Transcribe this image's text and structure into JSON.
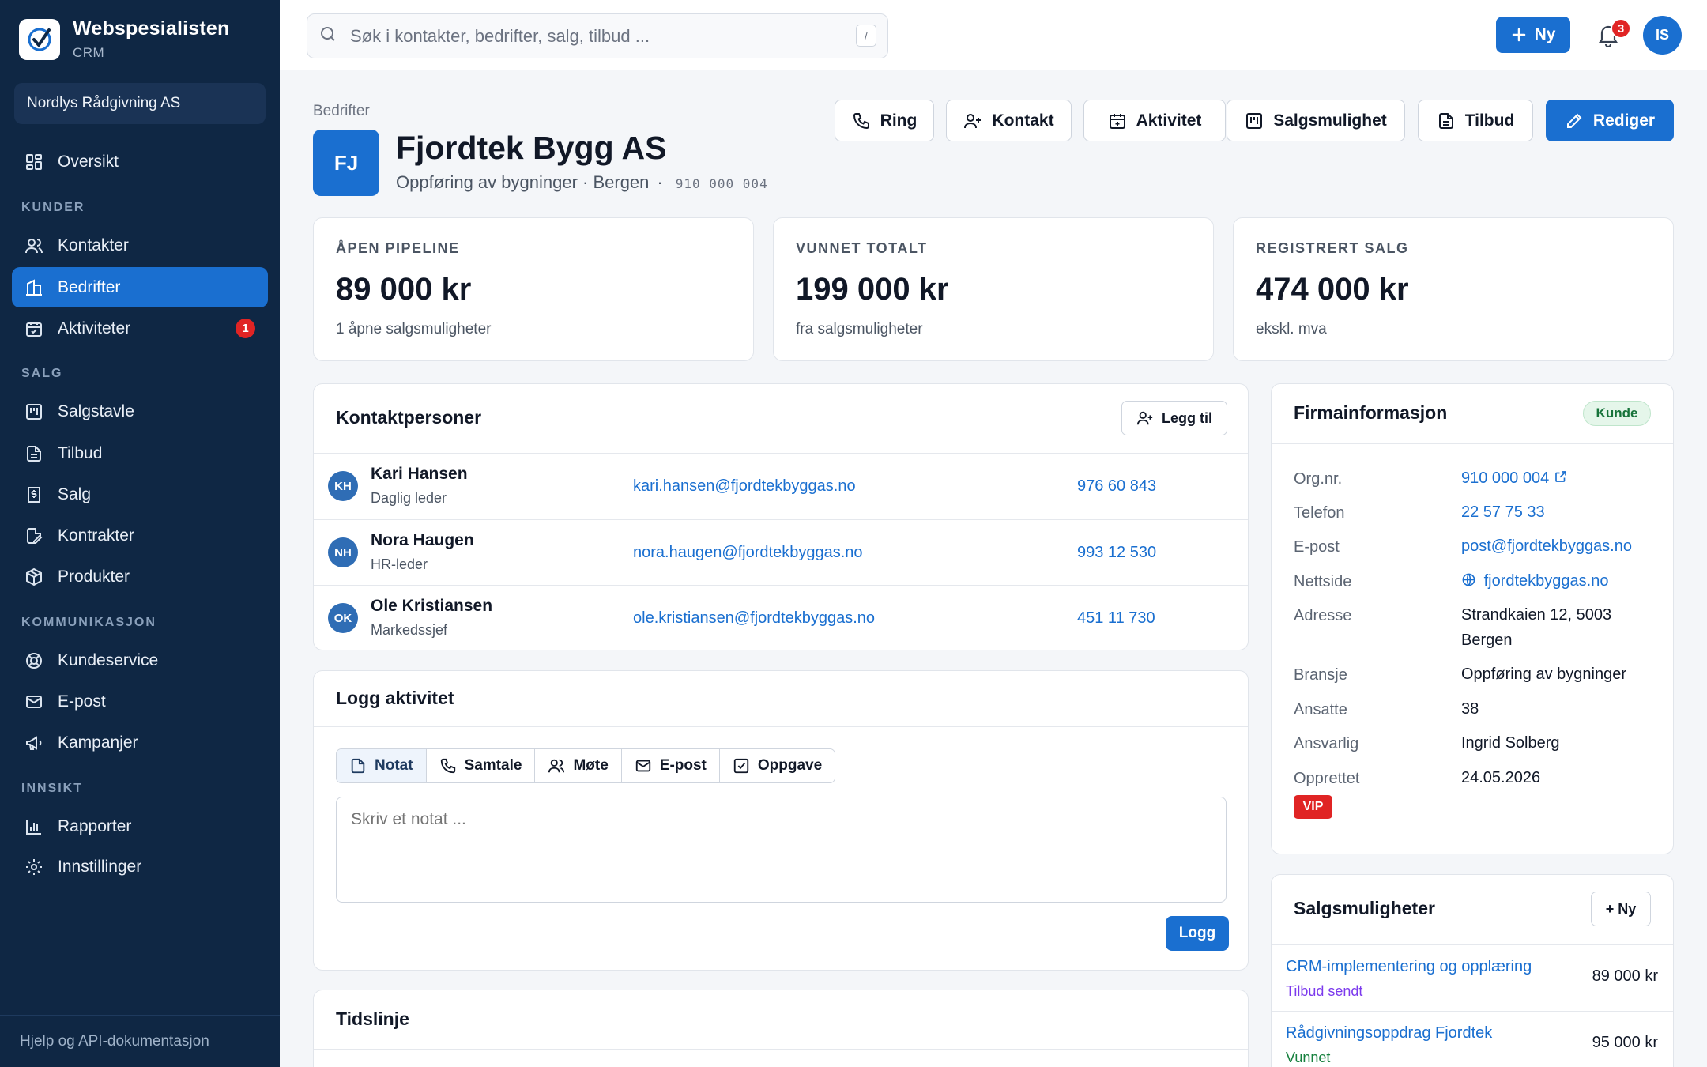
{
  "brand": {
    "name": "Webspesialisten",
    "sub": "CRM"
  },
  "org_switcher": "Nordlys Rådgivning AS",
  "nav": {
    "overview": "Oversikt",
    "sections": {
      "customers": "KUNDER",
      "sales": "SALG",
      "communication": "KOMMUNIKASJON",
      "insight": "INNSIKT"
    },
    "items": {
      "contacts": "Kontakter",
      "companies": "Bedrifter",
      "activities": "Aktiviteter",
      "activities_badge": "1",
      "pipeline": "Salgstavle",
      "quotes": "Tilbud",
      "sales": "Salg",
      "contracts": "Kontrakter",
      "products": "Produkter",
      "support": "Kundeservice",
      "email": "E-post",
      "campaigns": "Kampanjer",
      "reports": "Rapporter",
      "settings": "Innstillinger"
    },
    "footer": "Hjelp og API-dokumentasjon"
  },
  "topbar": {
    "search_placeholder": "Søk i kontakter, bedrifter, salg, tilbud ...",
    "search_shortcut": "/",
    "new_label": "Ny",
    "notifications": "3",
    "user_initials": "IS"
  },
  "header": {
    "breadcrumb": "Bedrifter",
    "initials": "FJ",
    "name": "Fjordtek Bygg AS",
    "meta": "Oppføring av bygninger · Bergen",
    "meta_sep": "·",
    "org_nr": "910 000 004",
    "actions": {
      "call": "Ring",
      "contact": "Kontakt",
      "activity": "Aktivitet",
      "opportunity": "Salgsmulighet",
      "quote": "Tilbud",
      "edit": "Rediger"
    }
  },
  "stats": [
    {
      "label": "ÅPEN PIPELINE",
      "value": "89 000 kr",
      "sub": "1 åpne salgsmuligheter"
    },
    {
      "label": "VUNNET TOTALT",
      "value": "199 000 kr",
      "sub": "fra salgsmuligheter"
    },
    {
      "label": "REGISTRERT SALG",
      "value": "474 000 kr",
      "sub": "ekskl. mva"
    }
  ],
  "contacts_card": {
    "title": "Kontaktpersoner",
    "add_label": "Legg til",
    "rows": [
      {
        "initials": "KH",
        "name": "Kari Hansen",
        "role": "Daglig leder",
        "email": "kari.hansen@fjordtekbyggas.no",
        "phone": "976 60 843"
      },
      {
        "initials": "NH",
        "name": "Nora Haugen",
        "role": "HR-leder",
        "email": "nora.haugen@fjordtekbyggas.no",
        "phone": "993 12 530"
      },
      {
        "initials": "OK",
        "name": "Ole Kristiansen",
        "role": "Markedssjef",
        "email": "ole.kristiansen@fjordtekbyggas.no",
        "phone": "451 11 730"
      }
    ]
  },
  "log_card": {
    "title": "Logg aktivitet",
    "tabs": {
      "note": "Notat",
      "call": "Samtale",
      "meeting": "Møte",
      "email": "E-post",
      "task": "Oppgave"
    },
    "placeholder": "Skriv et notat ...",
    "submit": "Logg"
  },
  "timeline_card": {
    "title": "Tidslinje"
  },
  "company_info": {
    "title": "Firmainformasjon",
    "status": "Kunde",
    "labels": {
      "org": "Org.nr.",
      "phone": "Telefon",
      "email": "E-post",
      "web": "Nettside",
      "address": "Adresse",
      "industry": "Bransje",
      "employees": "Ansatte",
      "owner": "Ansvarlig",
      "created": "Opprettet"
    },
    "values": {
      "org": "910 000 004",
      "phone": "22 57 75 33",
      "email": "post@fjordtekbyggas.no",
      "web": "fjordtekbyggas.no",
      "address": "Strandkaien 12, 5003 Bergen",
      "industry": "Oppføring av bygninger",
      "employees": "38",
      "owner": "Ingrid Solberg",
      "created": "24.05.2026"
    },
    "tag": "VIP"
  },
  "opportunities_card": {
    "title": "Salgsmuligheter",
    "new_label": "+ Ny",
    "rows": [
      {
        "name": "CRM-implementering og opplæring",
        "stage": "Tilbud sendt",
        "amount": "89 000 kr"
      },
      {
        "name": "Rådgivningsoppdrag Fjordtek",
        "stage": "Vunnet",
        "amount": "95 000 kr"
      }
    ]
  },
  "colors": {
    "sidebar": "#0f2744",
    "accent": "#1a6fd0",
    "danger": "#e02424",
    "stage_sent": "#7c3aed",
    "stage_won": "#15803d"
  }
}
